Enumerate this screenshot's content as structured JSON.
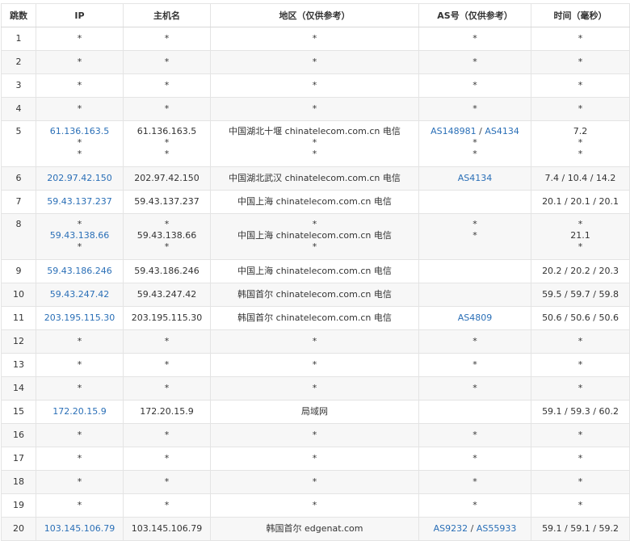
{
  "headers": {
    "hop": "跳数",
    "ip": "IP",
    "host": "主机名",
    "region": "地区（仅供参考）",
    "as": "AS号（仅供参考）",
    "time": "时间（毫秒）"
  },
  "colors": {
    "link": "#2a6fb7",
    "row_alt": "#f7f7f7",
    "border": "#e4e4e4"
  },
  "rows": [
    {
      "hop": "1",
      "ip": [
        {
          "t": "*"
        }
      ],
      "host": [
        "*"
      ],
      "region": [
        "*"
      ],
      "as": [
        [
          {
            "t": "*"
          }
        ]
      ],
      "time": [
        "*"
      ]
    },
    {
      "hop": "2",
      "ip": [
        {
          "t": "*"
        }
      ],
      "host": [
        "*"
      ],
      "region": [
        "*"
      ],
      "as": [
        [
          {
            "t": "*"
          }
        ]
      ],
      "time": [
        "*"
      ]
    },
    {
      "hop": "3",
      "ip": [
        {
          "t": "*"
        }
      ],
      "host": [
        "*"
      ],
      "region": [
        "*"
      ],
      "as": [
        [
          {
            "t": "*"
          }
        ]
      ],
      "time": [
        "*"
      ]
    },
    {
      "hop": "4",
      "ip": [
        {
          "t": "*"
        }
      ],
      "host": [
        "*"
      ],
      "region": [
        "*"
      ],
      "as": [
        [
          {
            "t": "*"
          }
        ]
      ],
      "time": [
        "*"
      ]
    },
    {
      "hop": "5",
      "ip": [
        {
          "t": "61.136.163.5",
          "link": true
        },
        {
          "t": "*"
        },
        {
          "t": "*"
        }
      ],
      "host": [
        "61.136.163.5",
        "*",
        "*"
      ],
      "region": [
        "中国湖北十堰 chinatelecom.com.cn 电信",
        "*",
        "*"
      ],
      "as": [
        [
          {
            "t": "AS148981",
            "link": true
          },
          {
            "t": " / "
          },
          {
            "t": "AS4134",
            "link": true
          }
        ],
        [
          {
            "t": "*"
          }
        ],
        [
          {
            "t": "*"
          }
        ]
      ],
      "time": [
        "7.2",
        "*",
        "*"
      ]
    },
    {
      "hop": "6",
      "ip": [
        {
          "t": "202.97.42.150",
          "link": true
        }
      ],
      "host": [
        "202.97.42.150"
      ],
      "region": [
        "中国湖北武汉 chinatelecom.com.cn 电信"
      ],
      "as": [
        [
          {
            "t": "AS4134",
            "link": true
          }
        ]
      ],
      "time": [
        "7.4 / 10.4 / 14.2"
      ]
    },
    {
      "hop": "7",
      "ip": [
        {
          "t": "59.43.137.237",
          "link": true
        }
      ],
      "host": [
        "59.43.137.237"
      ],
      "region": [
        "中国上海 chinatelecom.com.cn 电信"
      ],
      "as": [],
      "time": [
        "20.1 / 20.1 / 20.1"
      ]
    },
    {
      "hop": "8",
      "ip": [
        {
          "t": "*"
        },
        {
          "t": "59.43.138.66",
          "link": true
        },
        {
          "t": "*"
        }
      ],
      "host": [
        "*",
        "59.43.138.66",
        "*"
      ],
      "region": [
        "*",
        "中国上海 chinatelecom.com.cn 电信",
        "*"
      ],
      "as": [
        [
          {
            "t": "*"
          }
        ],
        [
          {
            "t": ""
          }
        ],
        [
          {
            "t": "*"
          }
        ]
      ],
      "time": [
        "*",
        "21.1",
        "*"
      ]
    },
    {
      "hop": "9",
      "ip": [
        {
          "t": "59.43.186.246",
          "link": true
        }
      ],
      "host": [
        "59.43.186.246"
      ],
      "region": [
        "中国上海 chinatelecom.com.cn 电信"
      ],
      "as": [],
      "time": [
        "20.2 / 20.2 / 20.3"
      ]
    },
    {
      "hop": "10",
      "ip": [
        {
          "t": "59.43.247.42",
          "link": true
        }
      ],
      "host": [
        "59.43.247.42"
      ],
      "region": [
        "韩国首尔 chinatelecom.com.cn 电信"
      ],
      "as": [],
      "time": [
        "59.5 / 59.7 / 59.8"
      ]
    },
    {
      "hop": "11",
      "ip": [
        {
          "t": "203.195.115.30",
          "link": true
        }
      ],
      "host": [
        "203.195.115.30"
      ],
      "region": [
        "韩国首尔 chinatelecom.com.cn 电信"
      ],
      "as": [
        [
          {
            "t": "AS4809",
            "link": true
          }
        ]
      ],
      "time": [
        "50.6 / 50.6 / 50.6"
      ]
    },
    {
      "hop": "12",
      "ip": [
        {
          "t": "*"
        }
      ],
      "host": [
        "*"
      ],
      "region": [
        "*"
      ],
      "as": [
        [
          {
            "t": "*"
          }
        ]
      ],
      "time": [
        "*"
      ]
    },
    {
      "hop": "13",
      "ip": [
        {
          "t": "*"
        }
      ],
      "host": [
        "*"
      ],
      "region": [
        "*"
      ],
      "as": [
        [
          {
            "t": "*"
          }
        ]
      ],
      "time": [
        "*"
      ]
    },
    {
      "hop": "14",
      "ip": [
        {
          "t": "*"
        }
      ],
      "host": [
        "*"
      ],
      "region": [
        "*"
      ],
      "as": [
        [
          {
            "t": "*"
          }
        ]
      ],
      "time": [
        "*"
      ]
    },
    {
      "hop": "15",
      "ip": [
        {
          "t": "172.20.15.9",
          "link": true
        }
      ],
      "host": [
        "172.20.15.9"
      ],
      "region": [
        "局域网"
      ],
      "as": [],
      "time": [
        "59.1 / 59.3 / 60.2"
      ]
    },
    {
      "hop": "16",
      "ip": [
        {
          "t": "*"
        }
      ],
      "host": [
        "*"
      ],
      "region": [
        "*"
      ],
      "as": [
        [
          {
            "t": "*"
          }
        ]
      ],
      "time": [
        "*"
      ]
    },
    {
      "hop": "17",
      "ip": [
        {
          "t": "*"
        }
      ],
      "host": [
        "*"
      ],
      "region": [
        "*"
      ],
      "as": [
        [
          {
            "t": "*"
          }
        ]
      ],
      "time": [
        "*"
      ]
    },
    {
      "hop": "18",
      "ip": [
        {
          "t": "*"
        }
      ],
      "host": [
        "*"
      ],
      "region": [
        "*"
      ],
      "as": [
        [
          {
            "t": "*"
          }
        ]
      ],
      "time": [
        "*"
      ]
    },
    {
      "hop": "19",
      "ip": [
        {
          "t": "*"
        }
      ],
      "host": [
        "*"
      ],
      "region": [
        "*"
      ],
      "as": [
        [
          {
            "t": "*"
          }
        ]
      ],
      "time": [
        "*"
      ]
    },
    {
      "hop": "20",
      "ip": [
        {
          "t": "103.145.106.79",
          "link": true
        }
      ],
      "host": [
        "103.145.106.79"
      ],
      "region": [
        "韩国首尔 edgenat.com"
      ],
      "as": [
        [
          {
            "t": "AS9232",
            "link": true
          },
          {
            "t": " / "
          },
          {
            "t": "AS55933",
            "link": true
          }
        ]
      ],
      "time": [
        "59.1 / 59.1 / 59.2"
      ]
    }
  ]
}
